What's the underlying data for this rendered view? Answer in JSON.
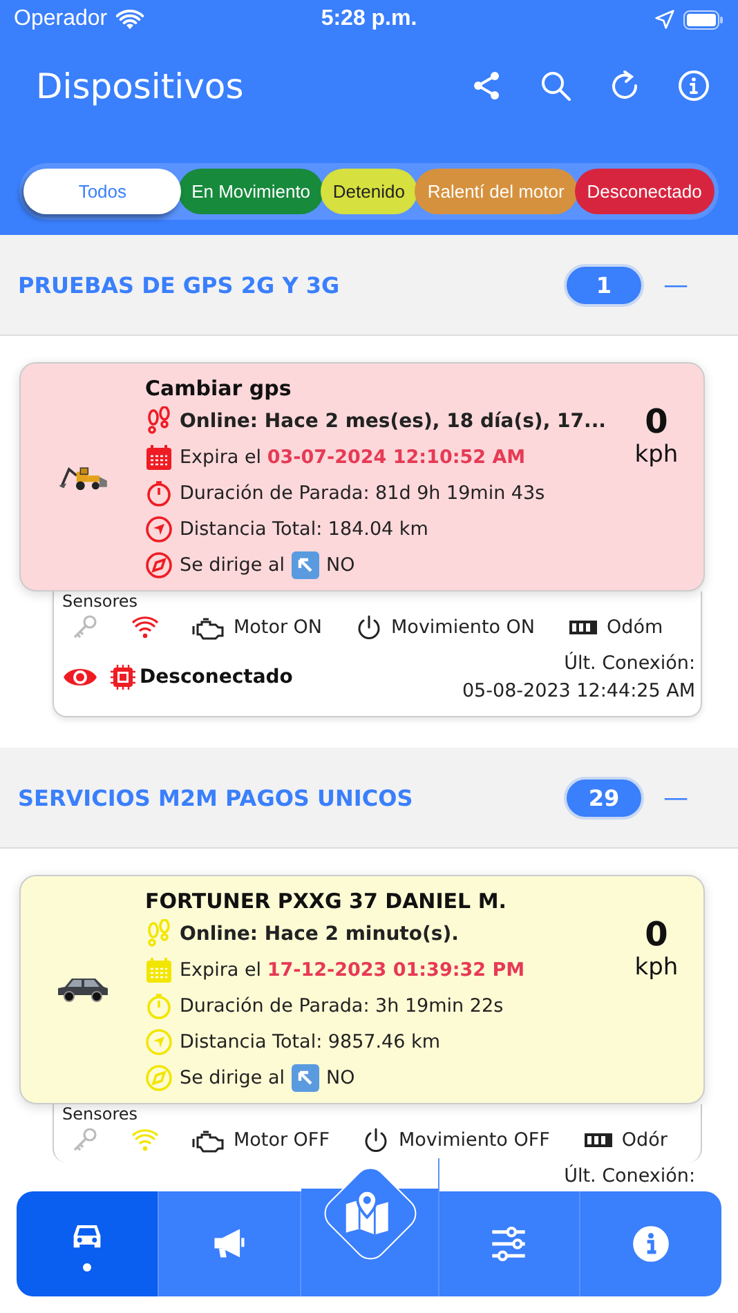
{
  "status_bar": {
    "carrier": "Operador",
    "time": "5:28 p.m."
  },
  "header": {
    "title": "Dispositivos"
  },
  "filters": [
    {
      "label": "Todos",
      "selected": true,
      "color": "#ffffff"
    },
    {
      "label": "En Movimiento",
      "selected": false,
      "color": "#178a3c"
    },
    {
      "label": "Detenido",
      "selected": false,
      "color": "#d6e03f"
    },
    {
      "label": "Ralentí del motor",
      "selected": false,
      "color": "#d6913e"
    },
    {
      "label": "Desconectado",
      "selected": false,
      "color": "#d8253f"
    }
  ],
  "groups": [
    {
      "name": "PRUEBAS DE GPS 2G Y 3G",
      "count": "1",
      "collapse": "—",
      "devices": [
        {
          "color": "#ef1c24",
          "kind": "backhoe",
          "name": "Cambiar gps",
          "speed": "0",
          "unit": "kph",
          "rows": [
            {
              "kind": "online",
              "text": "Online: Hace 2 mes(es), 18 día(s), 17..."
            },
            {
              "kind": "expiry",
              "text": "Expira el **03-07-2024 12:10:52 AM**"
            },
            {
              "kind": "stop",
              "text": "Duración de Parada: 81d 9h 19min 43s"
            },
            {
              "kind": "distance",
              "text": "Distancia Total: 184.04 km"
            },
            {
              "kind": "heading",
              "text": "Se dirige al",
              "value": "NO"
            }
          ],
          "sensors_label": "Sensores",
          "sensors": [
            {
              "kind": "key"
            },
            {
              "kind": "signal"
            },
            {
              "kind": "engine",
              "text": "Motor ON"
            },
            {
              "kind": "power",
              "text": "Movimiento ON"
            },
            {
              "kind": "odometer",
              "text": "Odóm"
            }
          ],
          "connection": "Desconectado",
          "last_label": "Últ. Conexión:",
          "last_time": "05-08-2023 12:44:25 AM"
        }
      ]
    },
    {
      "name": "SERVICIOS M2M PAGOS UNICOS",
      "count": "29",
      "collapse": "—",
      "devices": [
        {
          "color": "#f2e600",
          "kind": "suv",
          "name": "FORTUNER PXXG 37 DANIEL M.",
          "speed": "0",
          "unit": "kph",
          "rows": [
            {
              "kind": "online",
              "text": "Online: Hace 2 minuto(s)."
            },
            {
              "kind": "expiry",
              "text": "Expira el **17-12-2023 01:39:32 PM**"
            },
            {
              "kind": "stop",
              "text": "Duración de Parada: 3h 19min 22s"
            },
            {
              "kind": "distance",
              "text": "Distancia Total: 9857.46 km"
            },
            {
              "kind": "heading",
              "text": "Se dirige al",
              "value": "NO"
            }
          ],
          "sensors_label": "Sensores",
          "sensors": [
            {
              "kind": "key"
            },
            {
              "kind": "signal"
            },
            {
              "kind": "engine",
              "text": "Motor OFF"
            },
            {
              "kind": "power",
              "text": "Movimiento OFF"
            },
            {
              "kind": "odometer",
              "text": "Odór"
            }
          ],
          "last_label": "Últ. Conexión:"
        }
      ]
    }
  ],
  "tab_bar": [
    {
      "kind": "car",
      "selected": true
    },
    {
      "kind": "megaphone",
      "selected": false
    },
    {
      "kind": "map",
      "selected": false
    },
    {
      "kind": "sliders",
      "selected": false
    },
    {
      "kind": "info",
      "selected": false
    }
  ]
}
